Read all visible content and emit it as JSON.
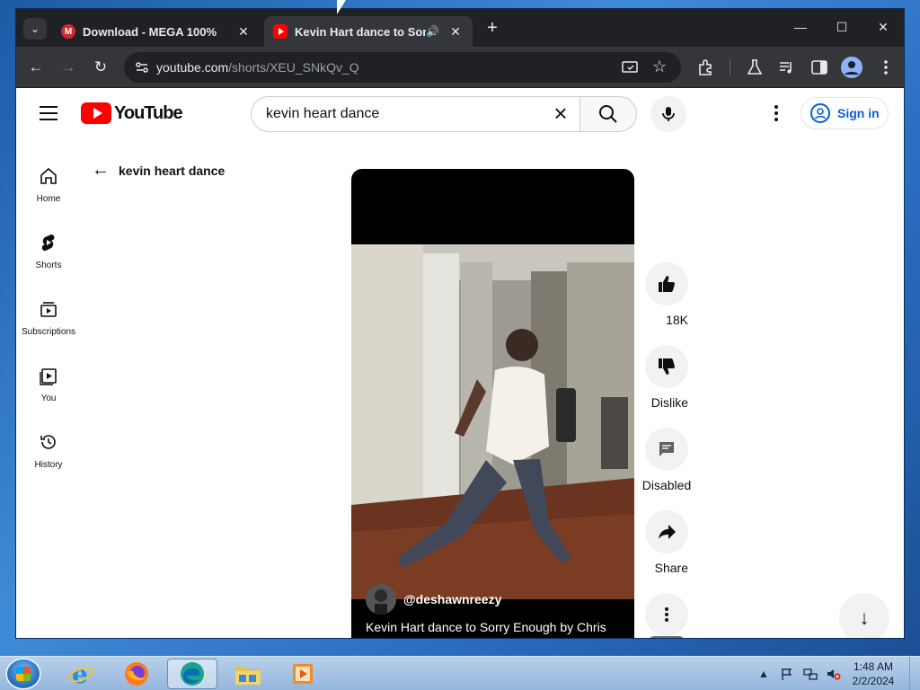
{
  "browser": {
    "tabs": [
      {
        "title": "Download - MEGA 100%",
        "favicon": "mega-icon",
        "active": false
      },
      {
        "title": "Kevin Hart dance to Sorry E",
        "favicon": "youtube-icon",
        "active": true,
        "audio": true
      }
    ],
    "tab_search_glyph": "⌄",
    "new_tab_glyph": "+",
    "close_glyph": "✕",
    "speaker_glyph": "🔊",
    "window_controls": {
      "minimize": "—",
      "maximize": "☐",
      "close": "✕"
    },
    "nav": {
      "back": "←",
      "forward": "→",
      "reload": "↻"
    },
    "url_host": "youtube.com",
    "url_path": "/shorts/XEU_SNkQv_Q",
    "toolbar_icons": [
      "cast-icon",
      "bookmark-star-icon",
      "extensions-icon",
      "labs-icon",
      "media-control-icon",
      "side-panel-icon",
      "profile-icon",
      "menu-dots-icon"
    ]
  },
  "youtube": {
    "logo_text": "YouTube",
    "search_value": "kevin heart dance",
    "signin_label": "Sign in",
    "guide": [
      {
        "label": "Home",
        "icon": "home-icon"
      },
      {
        "label": "Shorts",
        "icon": "shorts-icon"
      },
      {
        "label": "Subscriptions",
        "icon": "subscriptions-icon"
      },
      {
        "label": "You",
        "icon": "you-icon"
      },
      {
        "label": "History",
        "icon": "history-icon"
      }
    ],
    "back_query": "kevin heart dance",
    "short": {
      "channel": "@deshawnreezy",
      "title": "Kevin Hart dance to Sorry Enough by Chris Brown"
    },
    "actions": [
      {
        "label": "18K",
        "icon": "like-icon"
      },
      {
        "label": "Dislike",
        "icon": "dislike-icon"
      },
      {
        "label": "Disabled",
        "icon": "comments-icon"
      },
      {
        "label": "Share",
        "icon": "share-icon"
      },
      {
        "label": "",
        "icon": "more-vertical-icon"
      }
    ]
  },
  "taskbar": {
    "apps": [
      "internet-explorer-icon",
      "firefox-icon",
      "edge-icon",
      "file-explorer-icon",
      "media-player-icon"
    ],
    "active_app": "edge-icon",
    "clock_time": "1:48 AM",
    "clock_date": "2/2/2024"
  },
  "colors": {
    "youtube_red": "#ff0000",
    "signin_blue": "#065fd4",
    "chrome_dark": "#202124"
  }
}
